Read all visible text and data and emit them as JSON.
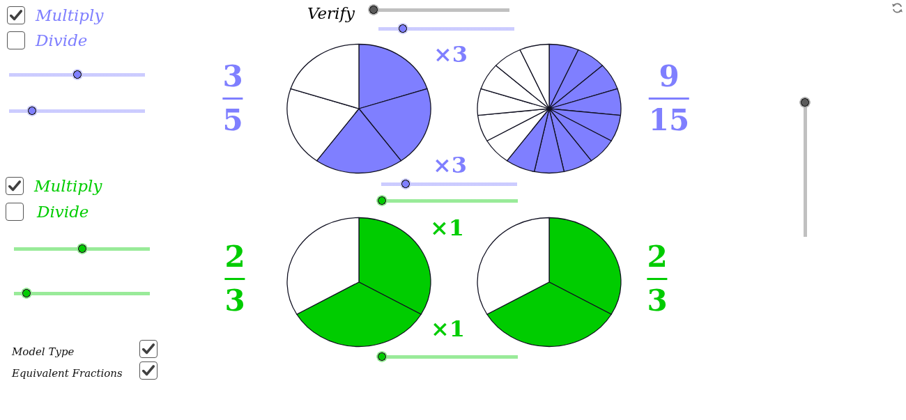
{
  "verify": {
    "label": "Verify",
    "level": 0
  },
  "fraction_sets": [
    {
      "color": "#7f7fff",
      "options": [
        {
          "label": "Multiply",
          "checked": true
        },
        {
          "label": "Divide",
          "checked": false
        }
      ],
      "sliders": [
        {
          "level": 0.5
        },
        {
          "level": 0.17
        }
      ],
      "factors": [
        {
          "text": "×3",
          "level": 0.18
        },
        {
          "text": "×3",
          "level": 0.18
        }
      ],
      "original": {
        "numerator": "3",
        "denominator": "5",
        "sectors": [
          {
            "filled": true
          },
          {
            "filled": true
          },
          {
            "filled": true
          },
          {
            "filled": false
          },
          {
            "filled": false
          }
        ]
      },
      "equivalent": {
        "numerator": "9",
        "denominator": "15",
        "sectors": [
          {
            "filled": true
          },
          {
            "filled": true
          },
          {
            "filled": true
          },
          {
            "filled": true
          },
          {
            "filled": true
          },
          {
            "filled": true
          },
          {
            "filled": true
          },
          {
            "filled": true
          },
          {
            "filled": true
          },
          {
            "filled": false
          },
          {
            "filled": false
          },
          {
            "filled": false
          },
          {
            "filled": false
          },
          {
            "filled": false
          },
          {
            "filled": false
          }
        ]
      }
    },
    {
      "color": "#00cc00",
      "options": [
        {
          "label": "Multiply",
          "checked": true
        },
        {
          "label": "Divide",
          "checked": false
        }
      ],
      "sliders": [
        {
          "level": 0.5
        },
        {
          "level": 0.09
        }
      ],
      "factors": [
        {
          "text": "×1",
          "level": 0
        },
        {
          "text": "×1",
          "level": 0
        }
      ],
      "original": {
        "numerator": "2",
        "denominator": "3",
        "sectors": [
          {
            "filled": true
          },
          {
            "filled": true
          },
          {
            "filled": false
          }
        ]
      },
      "equivalent": {
        "numerator": "2",
        "denominator": "3",
        "sectors": [
          {
            "filled": true
          },
          {
            "filled": true
          },
          {
            "filled": false
          }
        ]
      }
    }
  ],
  "settings": [
    {
      "label": "Model Type",
      "checked": true
    },
    {
      "label": "Equivalent Fractions",
      "checked": true
    }
  ],
  "vertical_slider": {
    "level": 1
  }
}
